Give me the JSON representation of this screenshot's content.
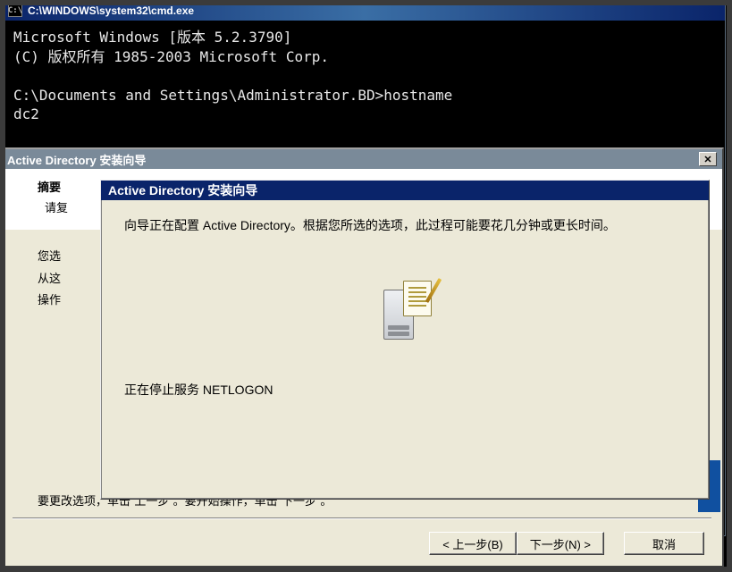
{
  "cmd": {
    "title": "C:\\WINDOWS\\system32\\cmd.exe",
    "icon_text": "C:\\",
    "lines": "Microsoft Windows [版本 5.2.3790]\n(C) 版权所有 1985-2003 Microsoft Corp.\n\nC:\\Documents and Settings\\Administrator.BD>hostname\ndc2\n"
  },
  "wizard_back": {
    "title": "Active Directory 安装向导",
    "summary_label": "摘要",
    "summary_sub": "请复",
    "body_line1": "您选",
    "body_line2": "从这",
    "body_line3": "操作",
    "instruction": "要更改选项，单击“上一步”。要开始操作，单击“下一步”。",
    "btn_back": "< 上一步(B)",
    "btn_next": "下一步(N) >",
    "btn_cancel": "取消"
  },
  "wizard_front": {
    "title": "Active Directory 安装向导",
    "message": "向导正在配置 Active Directory。根据您所选的选项，此过程可能要花几分钟或更长时间。",
    "status": "正在停止服务 NETLOGON"
  }
}
